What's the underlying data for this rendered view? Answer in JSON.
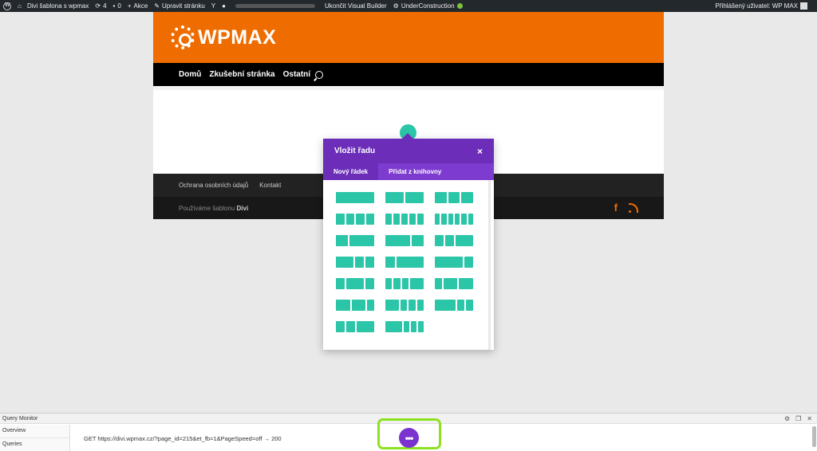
{
  "admin_bar": {
    "site_name": "Divi šablona s wpmax",
    "updates_count": "4",
    "comments_count": "0",
    "new_label": "Akce",
    "edit_page_label": "Upravit stránku",
    "exit_builder_label": "Ukončit Visual Builder",
    "under_construction_label": "UnderConstruction",
    "greeting": "Přihlášený uživatel: WP MAX"
  },
  "site": {
    "logo_text": "WPMAX",
    "brand_color": "#ef6c00",
    "nav": [
      "Domů",
      "Zkušební stránka",
      "Ostatní"
    ],
    "footer_links": [
      "Ochrana osobních údajů",
      "Kontakt"
    ],
    "credits_prefix": "Používáme šablonu",
    "credits_theme": "Divi"
  },
  "modal": {
    "title": "Vložit řadu",
    "close_symbol": "×",
    "tabs": [
      "Nový řádek",
      "Přidat z knihovny"
    ],
    "active_tab": "Nový řádek",
    "accent": "#6c2eb9",
    "layout_color": "#2bc5a8"
  },
  "query_monitor": {
    "title": "Query Monitor",
    "panels": [
      "Overview",
      "Queries"
    ],
    "request": "GET https://divi.wpmax.cz/?page_id=215&et_fb=1&PageSpeed=off → 200"
  },
  "more_button": {
    "symbol": "•••"
  }
}
